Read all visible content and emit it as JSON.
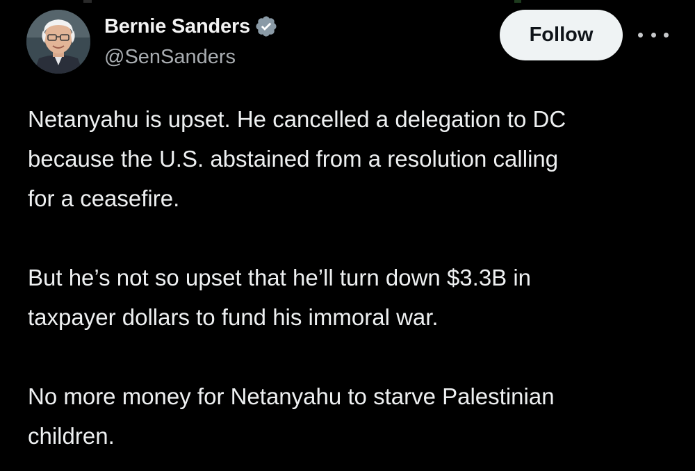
{
  "author": {
    "display_name": "Bernie Sanders",
    "handle": "@SenSanders",
    "verified": true,
    "avatar_icon": "profile-photo"
  },
  "actions": {
    "follow_label": "Follow",
    "more_icon": "more-horizontal-icon"
  },
  "tweet": {
    "paragraphs": [
      "Netanyahu is upset. He cancelled a delegation to DC\nbecause the U.S. abstained from a resolution calling\nfor a ceasefire.",
      "But he’s not so upset that he’ll turn down $3.3B in\ntaxpayer dollars to fund his immoral war.",
      "No more money for Netanyahu to starve Palestinian\nchildren."
    ]
  },
  "colors": {
    "background": "#000000",
    "text_primary": "#eef0f1",
    "text_secondary": "#a9adb1",
    "follow_bg": "#eff3f4",
    "verified_blue": "#1d9bf0"
  }
}
